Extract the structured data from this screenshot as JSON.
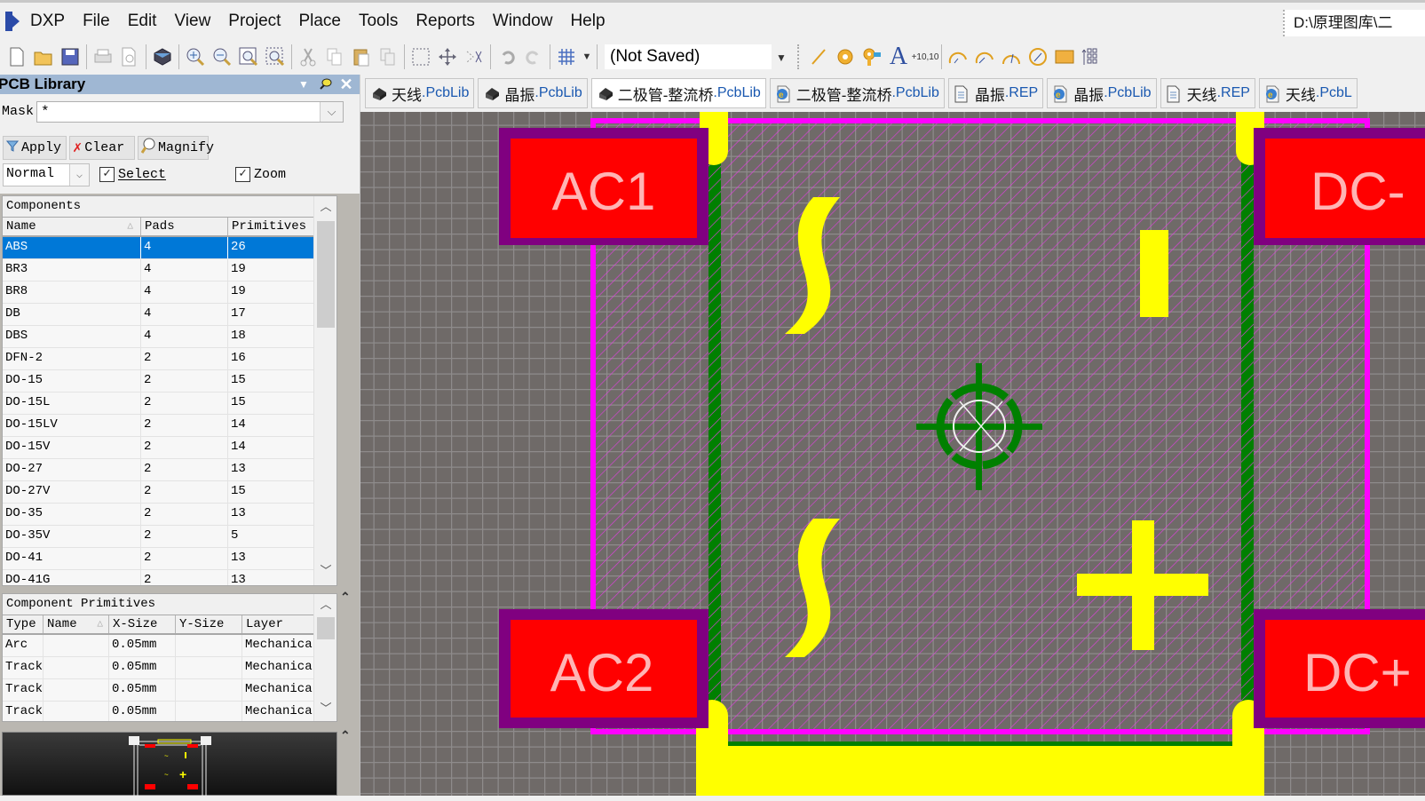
{
  "app": {
    "logo_label": "DXP",
    "menu": [
      "DXP",
      "File",
      "Edit",
      "View",
      "Project",
      "Place",
      "Tools",
      "Reports",
      "Window",
      "Help"
    ],
    "path": "D:\\原理图库\\二"
  },
  "toolbar": {
    "snap_value": "(Not Saved)",
    "groups": [
      [
        "new-file-icon",
        "open-folder-icon",
        "save-icon"
      ],
      [
        "print-icon",
        "print-preview-icon"
      ],
      [
        "3d-view-icon"
      ],
      [
        "zoom-in-icon",
        "zoom-out-icon",
        "zoom-fit-icon",
        "zoom-area-icon"
      ],
      [
        "cut-icon",
        "copy-icon",
        "paste-icon",
        "rubber-stamp-icon"
      ],
      [
        "select-area-icon",
        "move-icon",
        "deselect-icon"
      ],
      [
        "undo-icon",
        "redo-icon"
      ],
      [
        "grid-icon"
      ]
    ],
    "place_tools": [
      "place-line-icon",
      "place-pad-icon",
      "place-via-icon",
      "place-string-icon",
      "place-coordinate-icon"
    ],
    "arc_tools": [
      "arc-center-icon",
      "arc-edge-icon",
      "arc-any-icon",
      "full-circle-icon",
      "fill-icon",
      "array-paste-icon"
    ],
    "coordinate_label": "+10,10"
  },
  "panel": {
    "title": "PCB Library",
    "mask_label": "Mask",
    "mask_value": "*",
    "apply_label": "Apply",
    "clear_label": "Clear",
    "magnify_label": "Magnify",
    "mode_value": "Normal",
    "select_label": "Select",
    "select_checked": true,
    "zoom_label": "Zoom",
    "zoom_checked": true,
    "components": {
      "caption": "Components",
      "columns": [
        "Name",
        "Pads",
        "Primitives"
      ],
      "rows": [
        [
          "ABS",
          "4",
          "26"
        ],
        [
          "BR3",
          "4",
          "19"
        ],
        [
          "BR8",
          "4",
          "19"
        ],
        [
          "DB",
          "4",
          "17"
        ],
        [
          "DBS",
          "4",
          "18"
        ],
        [
          "DFN-2",
          "2",
          "16"
        ],
        [
          "DO-15",
          "2",
          "15"
        ],
        [
          "DO-15L",
          "2",
          "15"
        ],
        [
          "DO-15LV",
          "2",
          "14"
        ],
        [
          "DO-15V",
          "2",
          "14"
        ],
        [
          "DO-27",
          "2",
          "13"
        ],
        [
          "DO-27V",
          "2",
          "15"
        ],
        [
          "DO-35",
          "2",
          "13"
        ],
        [
          "DO-35V",
          "2",
          "5"
        ],
        [
          "DO-41",
          "2",
          "13"
        ],
        [
          "DO-41G",
          "2",
          "13"
        ]
      ],
      "selected_index": 0
    },
    "primitives": {
      "caption": "Component Primitives",
      "columns": [
        "Type",
        "Name",
        "X-Size",
        "Y-Size",
        "Layer"
      ],
      "rows": [
        [
          "Arc",
          "",
          "0.05mm",
          "",
          "Mechanica"
        ],
        [
          "Track",
          "",
          "0.05mm",
          "",
          "Mechanica"
        ],
        [
          "Track",
          "",
          "0.05mm",
          "",
          "Mechanica"
        ],
        [
          "Track",
          "",
          "0.05mm",
          "",
          "Mechanica"
        ]
      ]
    }
  },
  "doc_tabs": [
    {
      "name": "天线",
      "ext": ".PcbLib",
      "icon": "pcblib-icon",
      "active": false
    },
    {
      "name": "晶振",
      "ext": ".PcbLib",
      "icon": "pcblib-icon",
      "active": false
    },
    {
      "name": "二极管-整流桥",
      "ext": ".PcbLib",
      "icon": "pcblib-icon",
      "active": true
    },
    {
      "name": "二极管-整流桥",
      "ext": ".PcbLib",
      "icon": "web-doc-icon",
      "active": false
    },
    {
      "name": "晶振",
      "ext": ".REP",
      "icon": "text-doc-icon",
      "active": false
    },
    {
      "name": "晶振",
      "ext": ".PcbLib",
      "icon": "web-doc-icon",
      "active": false
    },
    {
      "name": "天线",
      "ext": ".REP",
      "icon": "text-doc-icon",
      "active": false
    },
    {
      "name": "天线",
      "ext": ".PcbL",
      "icon": "web-doc-icon",
      "active": false
    }
  ],
  "canvas": {
    "pads": [
      {
        "label": "AC1",
        "pos": "top-left"
      },
      {
        "label": "DC-",
        "pos": "top-right"
      },
      {
        "label": "AC2",
        "pos": "bottom-left"
      },
      {
        "label": "DC+",
        "pos": "bottom-right"
      }
    ],
    "colors": {
      "background": "#6f6a68",
      "grid": "#8c8a8a",
      "keepout": "#ff00ff",
      "pad_copper": "#ff0000",
      "pad_mask": "#800080",
      "silkscreen": "#ffff00",
      "mechanical": "#008000",
      "pad_text": "#ffb4b4"
    }
  }
}
